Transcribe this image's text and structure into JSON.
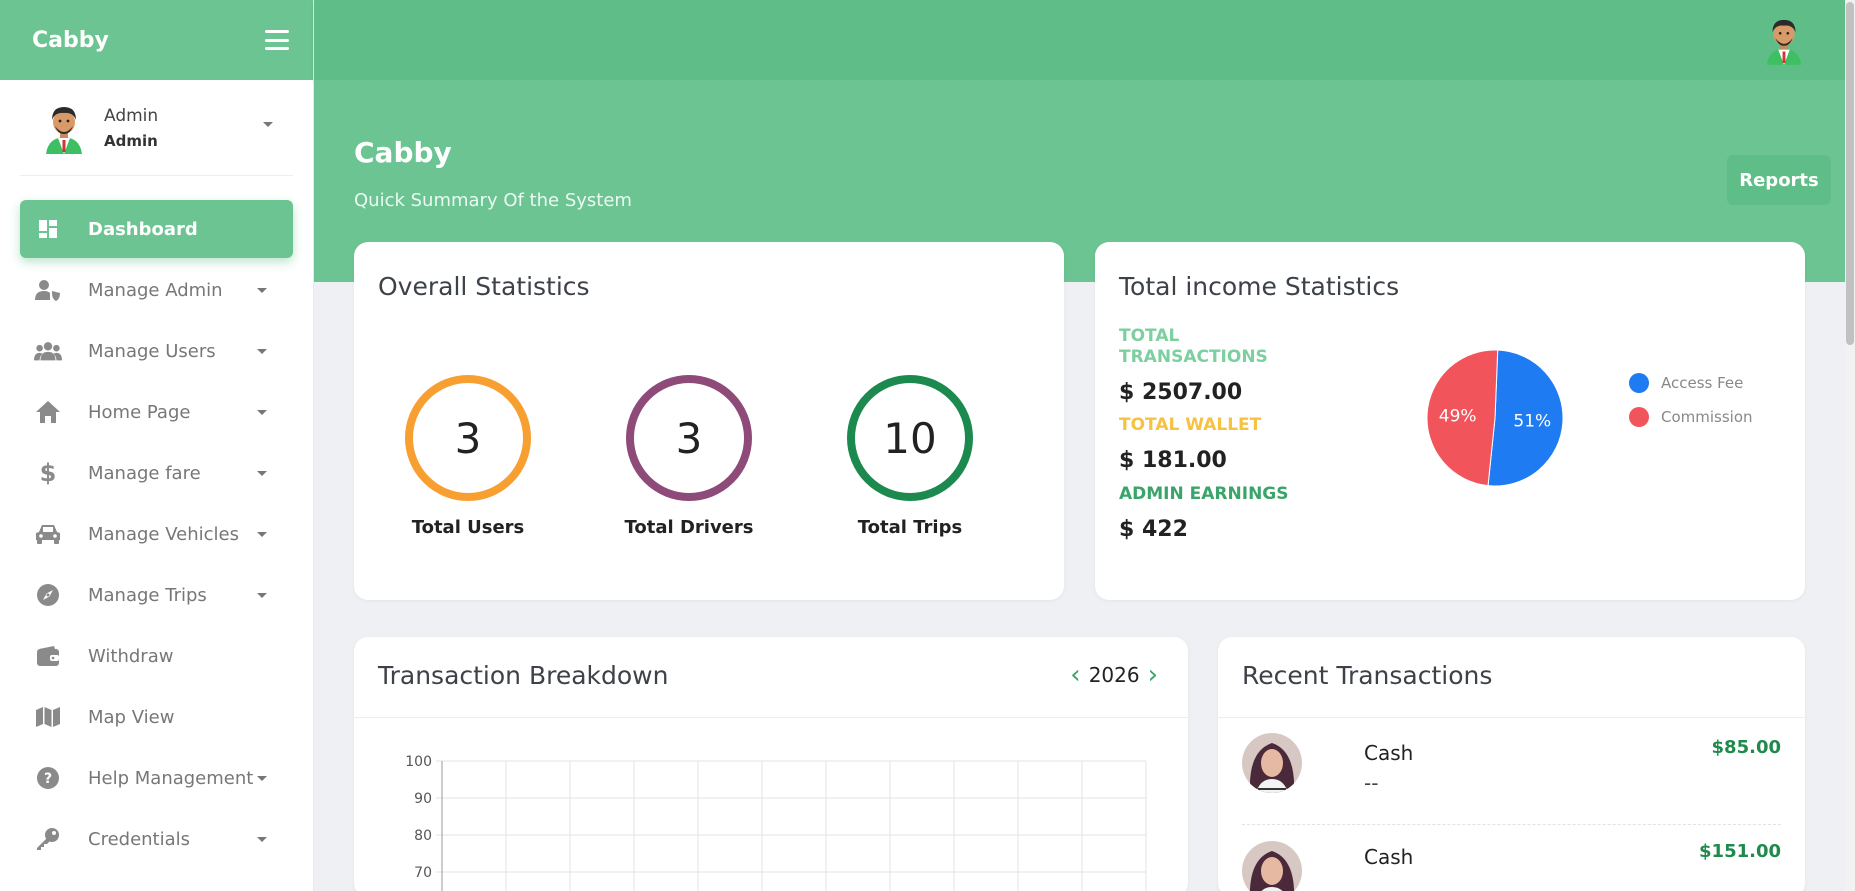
{
  "sidebar": {
    "brand": "Cabby",
    "profile": {
      "name": "Admin",
      "role": "Admin"
    },
    "items": [
      {
        "label": "Dashboard",
        "icon": "dashboard-icon",
        "active": true,
        "has_caret": false
      },
      {
        "label": "Manage Admin",
        "icon": "admin-shield-icon",
        "has_caret": true
      },
      {
        "label": "Manage Users",
        "icon": "users-icon",
        "has_caret": true
      },
      {
        "label": "Home Page",
        "icon": "home-icon",
        "has_caret": true
      },
      {
        "label": "Manage fare",
        "icon": "dollar-icon",
        "has_caret": true
      },
      {
        "label": "Manage Vehicles",
        "icon": "car-icon",
        "has_caret": true
      },
      {
        "label": "Manage Trips",
        "icon": "compass-icon",
        "has_caret": true
      },
      {
        "label": "Withdraw",
        "icon": "wallet-icon",
        "has_caret": false
      },
      {
        "label": "Map View",
        "icon": "map-icon",
        "has_caret": false
      },
      {
        "label": "Help Management",
        "icon": "help-icon",
        "has_caret": true
      },
      {
        "label": "Credentials",
        "icon": "key-icon",
        "has_caret": true
      }
    ]
  },
  "hero": {
    "title": "Cabby",
    "subtitle": "Quick Summary Of the System",
    "reports_label": "Reports"
  },
  "overall": {
    "title": "Overall Statistics",
    "stats": [
      {
        "value": "3",
        "label": "Total Users",
        "color": "#f7a031"
      },
      {
        "value": "3",
        "label": "Total Drivers",
        "color": "#8e4a78"
      },
      {
        "value": "10",
        "label": "Total Trips",
        "color": "#1c8a4f"
      }
    ]
  },
  "income": {
    "title": "Total income Statistics",
    "total_transactions_label": "TOTAL TRANSACTIONS",
    "total_transactions_value": "$ 2507.00",
    "total_wallet_label": "TOTAL WALLET",
    "total_wallet_value": "$ 181.00",
    "admin_earnings_label": "ADMIN EARNINGS",
    "admin_earnings_value": "$ 422",
    "colors": {
      "transactions": "#7ccf9f",
      "wallet": "#f5c242",
      "earnings": "#3aa46a"
    }
  },
  "breakdown": {
    "title": "Transaction Breakdown",
    "year": "2026"
  },
  "recent": {
    "title": "Recent Transactions",
    "items": [
      {
        "type": "Cash",
        "sub": "--",
        "amount": "$85.00"
      },
      {
        "type": "Cash",
        "sub": "",
        "amount": "$151.00"
      }
    ]
  },
  "chart_data": [
    {
      "type": "pie",
      "title": "",
      "categories": [
        "Access Fee",
        "Commission"
      ],
      "values": [
        51,
        49
      ],
      "labels": [
        "51%",
        "49%"
      ],
      "colors": [
        "#1f7bf2",
        "#f2545b"
      ],
      "legend": "right"
    },
    {
      "type": "line",
      "title": "",
      "series": [],
      "yticks": [
        "100",
        "90",
        "80",
        "70"
      ],
      "ylim": [
        70,
        100
      ],
      "grid": true
    }
  ]
}
